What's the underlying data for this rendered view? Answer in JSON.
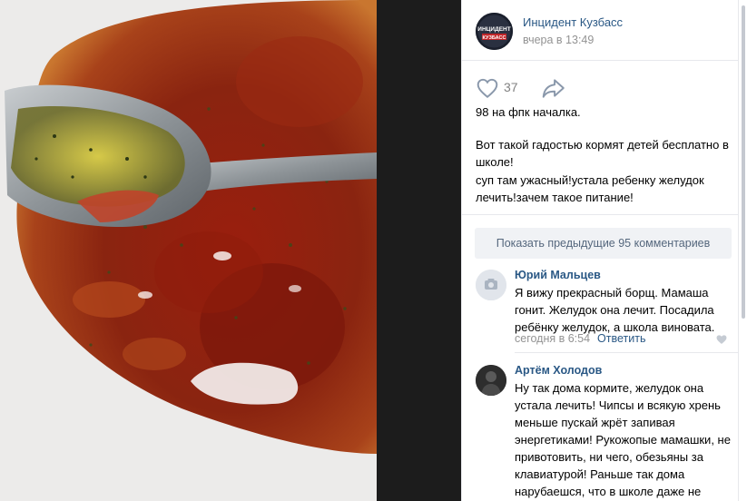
{
  "photo": {
    "icon": "borscht-photo"
  },
  "post": {
    "group_name": "Инцидент Кузбасс",
    "avatar_text": [
      "ИНЦИДЕНТ",
      "КУЗБАСС"
    ],
    "time": "вчера в 13:49",
    "like_count": "37",
    "text": {
      "line1": "98 на фпк началка.",
      "line2": "Вот такой гадостью кормят детей бесплатно в школе!",
      "line3": "суп там ужасный!устала ребенку желудок лечить!зачем такое питание!"
    }
  },
  "show_previous": "Показать предыдущие 95 комментариев",
  "comments": [
    {
      "author": "Юрий Мальцев",
      "text": "Я вижу прекрасный борщ. Мамаша гонит. Желудок она лечит. Посадила ребёнку желудок, а школа виновата.",
      "time": "сегодня в 6:54",
      "reply": "Ответить"
    },
    {
      "author": "Артём Холодов",
      "text": "Ну так дома кормите, желудок она устала лечить! Чипсы и всякую хрень меньше пускай жрёт запивая энергетиками! Рукожопые мамашки, не привотовить, ни чего, обезьяны за клавиатурой! Раньше так дома нарубаешся, что в школе даже не смотрели в сторону столовки! ..."
    }
  ],
  "colors": {
    "link": "#2a5885",
    "muted": "#939393",
    "button_bg": "#f0f2f5",
    "backdrop": "#1c1c1c"
  }
}
